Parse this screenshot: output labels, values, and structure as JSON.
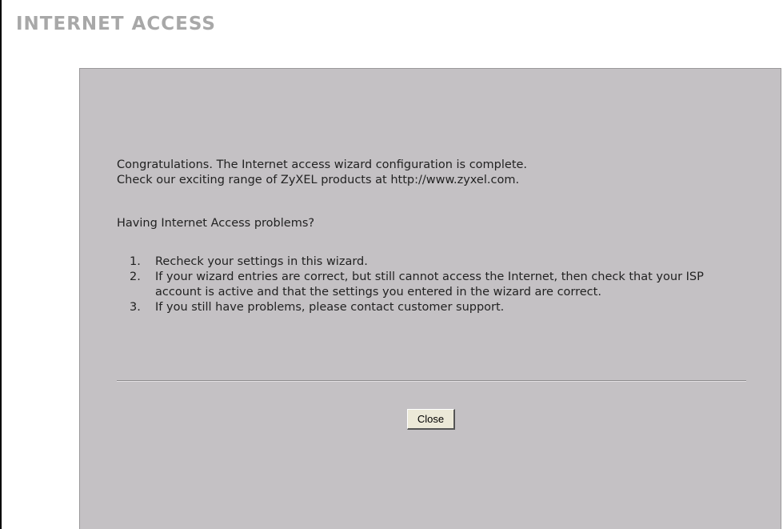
{
  "header": {
    "title": "INTERNET ACCESS"
  },
  "panel": {
    "congrats_line1": "Congratulations. The Internet access wizard configuration is complete.",
    "congrats_line2": "Check our exciting range of ZyXEL products at http://www.zyxel.com.",
    "problems_heading": "Having Internet Access problems?",
    "steps": [
      {
        "number": "1.",
        "text": "Recheck your settings in this wizard."
      },
      {
        "number": "2.",
        "text": "If your wizard entries are correct, but still cannot access the Internet, then check that your ISP account is active and that the settings you entered in the wizard are correct."
      },
      {
        "number": "3.",
        "text": "If you still have problems, please contact customer support."
      }
    ],
    "close_label": "Close"
  },
  "colors": {
    "title": "#a8a8a8",
    "panel_background": "#c4c1c4",
    "text": "#222222",
    "button_face": "#ece9d8"
  }
}
